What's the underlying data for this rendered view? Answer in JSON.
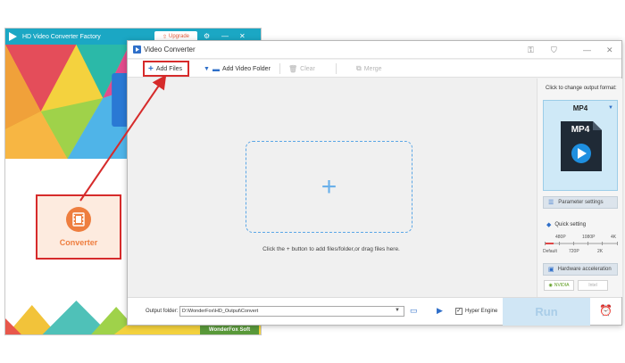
{
  "back_window": {
    "title": "HD Video Converter Factory",
    "upgrade_label": "Upgrade",
    "converter_label": "Converter",
    "brand_badge": "WonderFox Soft"
  },
  "main_window": {
    "title": "Video Converter",
    "toolbar": {
      "add_files": "Add Files",
      "add_video_folder": "Add Video Folder",
      "clear": "Clear",
      "merge": "Merge"
    },
    "drop_hint": "Click the + button to add files/folder,or drag files here.",
    "right_panel": {
      "change_format_label": "Click to change output format:",
      "format": "MP4",
      "format_icon_text": "MP4",
      "parameter_settings": "Parameter settings",
      "quick_setting": "Quick setting",
      "quality_top": [
        "480P",
        "1080P",
        "4K"
      ],
      "quality_bottom": [
        "Default",
        "720P",
        "2K"
      ],
      "hardware_acceleration": "Hardware acceleration",
      "gpu_nvidia": "NVIDIA",
      "gpu_intel": "Intel"
    },
    "bottom": {
      "output_folder_label": "Output folder:",
      "output_path": "D:\\WonderFox\\HD_Output\\Convert",
      "hyper_engine": "Hyper Engine",
      "run": "Run"
    }
  },
  "colors": {
    "accent_blue": "#2f6fc9",
    "annotation_red": "#d62b2b",
    "converter_orange": "#ee7e3f",
    "titlebar_teal": "#1ba7c4"
  }
}
